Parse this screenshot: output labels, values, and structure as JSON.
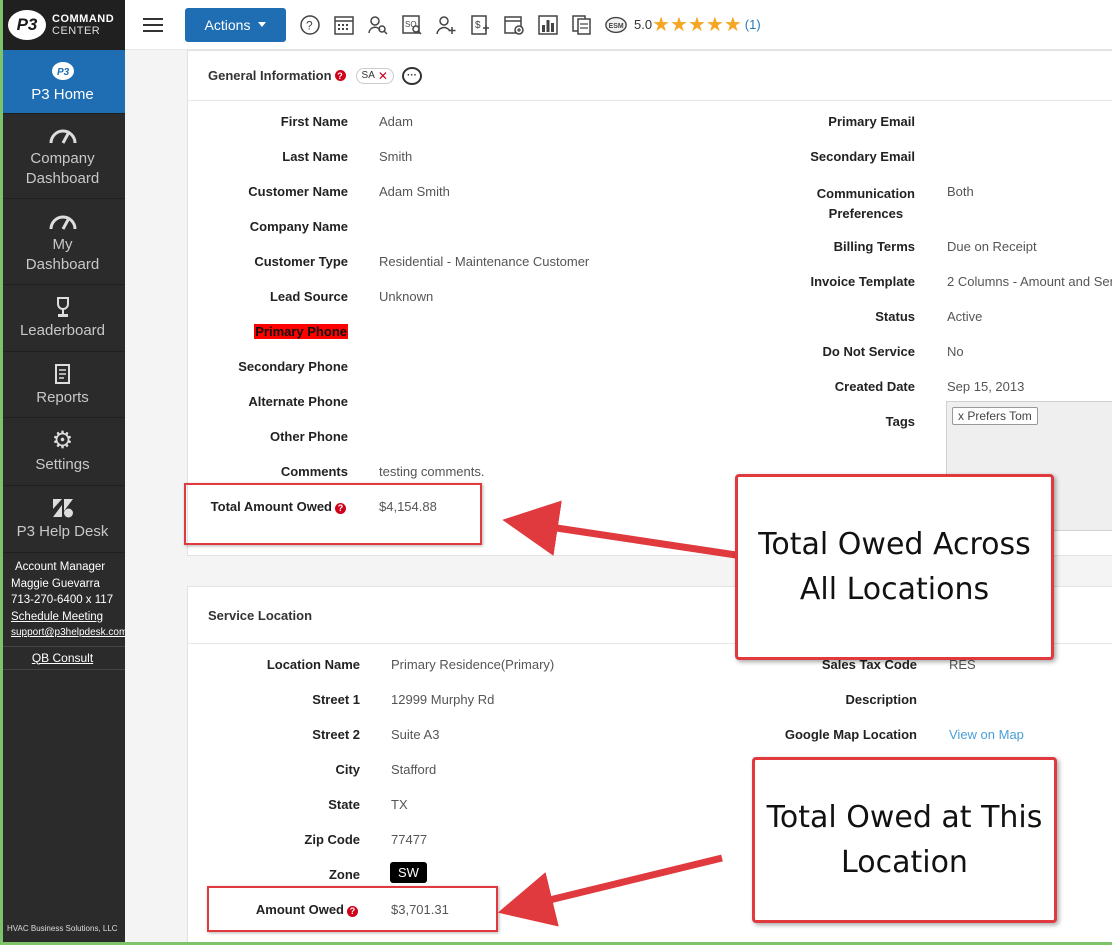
{
  "brand": {
    "line1": "COMMAND",
    "line2": "CENTER",
    "mark": "P3"
  },
  "sidebar": {
    "items": [
      {
        "label": "P3 Home",
        "icon": "p3-logo-icon",
        "active": true
      },
      {
        "label": "Company Dashboard",
        "icon": "gauge-icon"
      },
      {
        "label": "My Dashboard",
        "icon": "gauge-icon"
      },
      {
        "label": "Leaderboard",
        "icon": "trophy-icon"
      },
      {
        "label": "Reports",
        "icon": "report-icon"
      },
      {
        "label": "Settings",
        "icon": "gear-icon"
      },
      {
        "label": "P3 Help Desk",
        "icon": "zendesk-icon"
      }
    ],
    "account": {
      "title": "Account Manager",
      "name": "Maggie Guevarra",
      "phone": "713-270-6400 x 117",
      "schedule": "Schedule Meeting",
      "email": "support@p3helpdesk.com",
      "qb": "QB Consult"
    },
    "footer": "HVAC Business Solutions, LLC"
  },
  "topbar": {
    "actions_label": "Actions",
    "rating_value": "5.0",
    "rating_stars": 5,
    "rating_count": "(1)",
    "esm_label": "ESM"
  },
  "general": {
    "title": "General Information",
    "chip": "SA",
    "left": [
      {
        "label": "First Name",
        "value": "Adam"
      },
      {
        "label": "Last Name",
        "value": "Smith"
      },
      {
        "label": "Customer Name",
        "value": "Adam Smith"
      },
      {
        "label": "Company Name",
        "value": ""
      },
      {
        "label": "Customer Type",
        "value": "Residential - Maintenance Customer"
      },
      {
        "label": "Lead Source",
        "value": "Unknown"
      },
      {
        "label": "Primary Phone",
        "value": ""
      },
      {
        "label": "Secondary Phone",
        "value": ""
      },
      {
        "label": "Alternate Phone",
        "value": ""
      },
      {
        "label": "Other Phone",
        "value": ""
      },
      {
        "label": "Comments",
        "value": "testing comments."
      }
    ],
    "total_owed_label": "Total Amount Owed",
    "total_owed_value": "$4,154.88",
    "right": [
      {
        "label": "Primary Email",
        "value": ""
      },
      {
        "label": "Secondary Email",
        "value": ""
      },
      {
        "label": "Communication",
        "label2": "Preferences",
        "value": "Both"
      },
      {
        "label": "Billing Terms",
        "value": "Due on Receipt"
      },
      {
        "label": "Invoice Template",
        "value": "2 Columns - Amount and Ser"
      },
      {
        "label": "Status",
        "value": "Active"
      },
      {
        "label": "Do Not Service",
        "value": "No"
      },
      {
        "label": "Created Date",
        "value": "Sep 15, 2013"
      },
      {
        "label": "Tags",
        "value": ""
      }
    ],
    "tag": "x  Prefers Tom"
  },
  "service": {
    "title": "Service Location",
    "left": [
      {
        "label": "Location Name",
        "value": "Primary Residence(Primary)"
      },
      {
        "label": "Street 1",
        "value": "12999 Murphy Rd"
      },
      {
        "label": "Street 2",
        "value": "Suite A3"
      },
      {
        "label": "City",
        "value": "Stafford"
      },
      {
        "label": "State",
        "value": "TX"
      },
      {
        "label": "Zip Code",
        "value": "77477"
      },
      {
        "label": "Zone",
        "value": "SW"
      }
    ],
    "amount_owed_label": "Amount Owed",
    "amount_owed_value": "$3,701.31",
    "right": [
      {
        "label": "Sales Tax Code",
        "value": "RES"
      },
      {
        "label": "Description",
        "value": ""
      },
      {
        "label": "Google Map Location",
        "value": "View on Map"
      }
    ]
  },
  "callouts": {
    "top": [
      "Total Owed Across",
      "All Locations"
    ],
    "bottom": [
      "Total Owed at This",
      "Location"
    ]
  },
  "colors": {
    "accent": "#1f6db3",
    "annotation": "#e03a3e",
    "highlight": "#ff0000",
    "star": "#f5a623"
  }
}
